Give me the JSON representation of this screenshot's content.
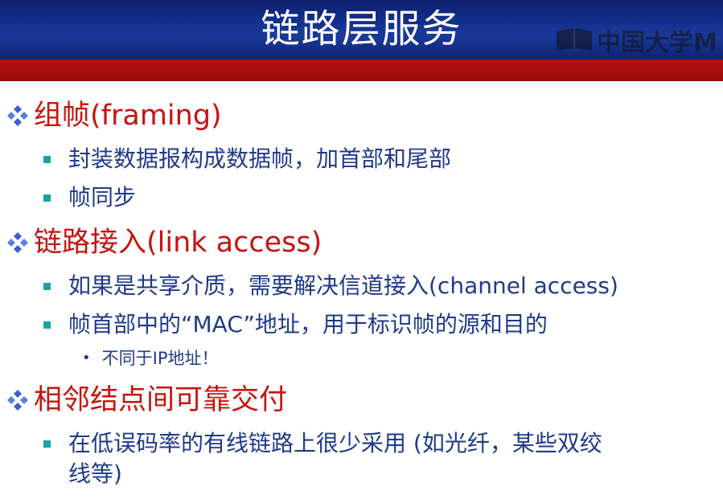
{
  "slide": {
    "title": "链路层服务",
    "watermark": "中国大学M",
    "colors": {
      "header": "#14318f",
      "accent_bar": "#b1100c",
      "level1": "#c5140f",
      "body": "#1f3a8a",
      "square_bullet": "#1aa3a3"
    }
  },
  "sections": [
    {
      "heading": "组帧(framing)",
      "items": [
        "封装数据报构成数据帧，加首部和尾部",
        "帧同步"
      ]
    },
    {
      "heading": "链路接入(link access)",
      "items": [
        "如果是共享介质，需要解决信道接入(channel access)",
        "帧首部中的“MAC”地址，用于标识帧的源和目的"
      ],
      "subitem": "不同于IP地址！"
    },
    {
      "heading": "相邻结点间可靠交付",
      "items": [
        "在低误码率的有线链路上很少采用 (如光纤，某些双绞"
      ],
      "item_continuation": "线等)"
    }
  ]
}
